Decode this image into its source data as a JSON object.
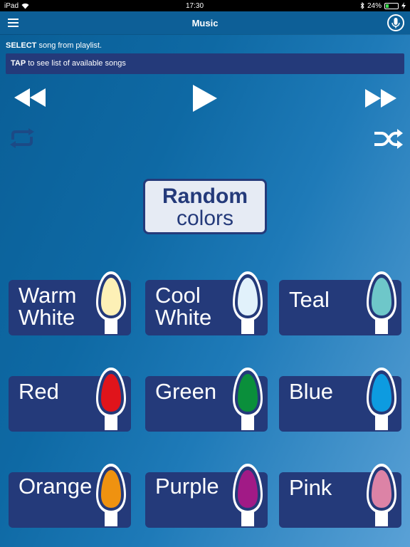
{
  "status": {
    "device": "iPad",
    "time": "17:30",
    "battery": "24%"
  },
  "nav": {
    "title": "Music",
    "menu_icon": "hamburger-menu-icon",
    "mic_icon": "microphone-icon"
  },
  "instructions": {
    "select_bold": "SELECT",
    "select_rest": " song from playlist.",
    "tap_bold": "TAP",
    "tap_rest": " to see list of available songs"
  },
  "controls": [
    "rewind-icon",
    "play-icon",
    "fast-forward-icon",
    "repeat-icon",
    "shuffle-icon"
  ],
  "random": {
    "line1": "Random",
    "line2": "colors"
  },
  "colors": [
    {
      "label": "Warm\nWhite",
      "bulb": "#fdf0b6"
    },
    {
      "label": "Cool\nWhite",
      "bulb": "#e1f1fb"
    },
    {
      "label": "Teal",
      "bulb": "#6ec7c9"
    },
    {
      "label": "Red",
      "bulb": "#e0141b"
    },
    {
      "label": "Green",
      "bulb": "#0a8f3b"
    },
    {
      "label": "Blue",
      "bulb": "#0d9be0"
    },
    {
      "label": "Orange",
      "bulb": "#ef9210"
    },
    {
      "label": "Purple",
      "bulb": "#a11a86"
    },
    {
      "label": "Pink",
      "bulb": "#dc83a6"
    }
  ]
}
